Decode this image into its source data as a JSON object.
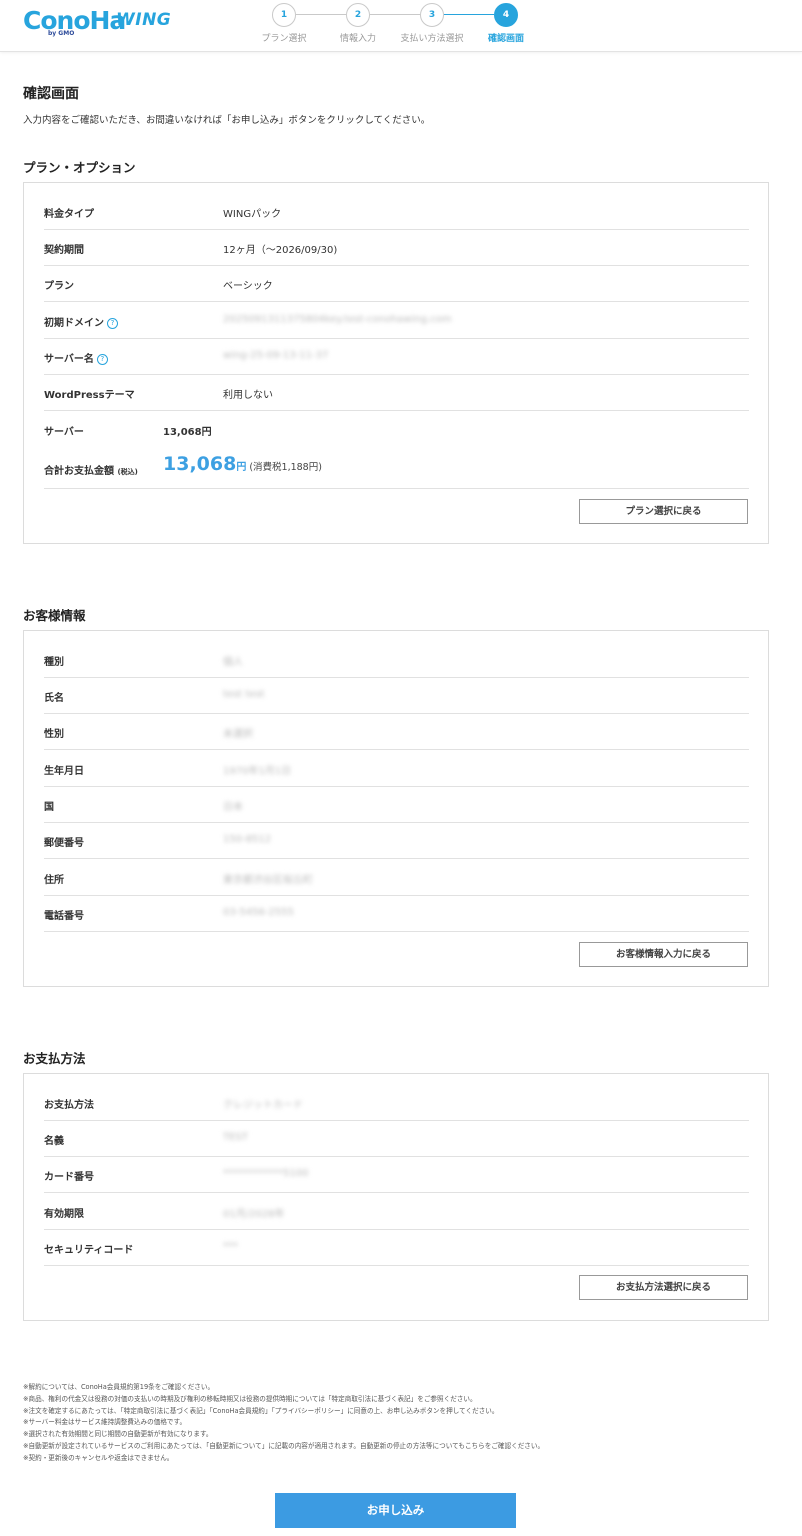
{
  "brand": {
    "logo_main": "ConoHa",
    "logo_sub": "by GMO",
    "logo_wing": "WING"
  },
  "stepper": [
    {
      "num": "1",
      "label": "プラン選択"
    },
    {
      "num": "2",
      "label": "情報入力"
    },
    {
      "num": "3",
      "label": "支払い方法選択"
    },
    {
      "num": "4",
      "label": "確認画面"
    }
  ],
  "page": {
    "title": "確認画面",
    "description": "入力内容をご確認いただき、お間違いなければ「お申し込み」ボタンをクリックしてください。"
  },
  "plan_section": {
    "title": "プラン・オプション",
    "rows": [
      {
        "label": "料金タイプ",
        "value": "WINGパック"
      },
      {
        "label": "契約期間",
        "value": "12ヶ月（〜2026/09/30)"
      },
      {
        "label": "プラン",
        "value": "ベーシック"
      },
      {
        "label": "初期ドメイン",
        "value": "2025091311375804key.test-conohawing.com"
      },
      {
        "label": "サーバー名",
        "value": "wing-25-09-13-11-37"
      },
      {
        "label": "WordPressテーマ",
        "value": "利用しない"
      }
    ],
    "server_label": "サーバー",
    "server_price": "13,068円",
    "total_label": "合計お支払金額",
    "total_tax_note": "(税込)",
    "total_amount": "13,068",
    "total_yen": "円",
    "total_tax": "(消費税1,188円)",
    "back_button": "プラン選択に戻る"
  },
  "customer_section": {
    "title": "お客様情報",
    "rows": [
      {
        "label": "種別",
        "value": "個人"
      },
      {
        "label": "氏名",
        "value": "test test"
      },
      {
        "label": "性別",
        "value": "未選択"
      },
      {
        "label": "生年月日",
        "value": "1970年1月1日"
      },
      {
        "label": "国",
        "value": "日本"
      },
      {
        "label": "郵便番号",
        "value": "150-8512"
      },
      {
        "label": "住所",
        "value": "東京都渋谷区桜丘町"
      },
      {
        "label": "電話番号",
        "value": "03-5456-2555"
      }
    ],
    "back_button": "お客様情報入力に戻る"
  },
  "payment_section": {
    "title": "お支払方法",
    "rows": [
      {
        "label": "お支払方法",
        "value": "クレジットカード"
      },
      {
        "label": "名義",
        "value": "TEST"
      },
      {
        "label": "カード番号",
        "value": "************5100"
      },
      {
        "label": "有効期限",
        "value": "01月/2028年"
      },
      {
        "label": "セキュリティコード",
        "value": "***"
      }
    ],
    "back_button": "お支払方法選択に戻る"
  },
  "notes": [
    "※解約については、ConoHa会員規約第19条をご確認ください。",
    "※商品、権利の代金又は役務の対価の支払いの時期及び権利の移転時期又は役務の提供時期については「特定商取引法に基づく表記」をご参照ください。",
    "※注文を確定するにあたっては、「特定商取引法に基づく表記」「ConoHa会員規約」「プライバシーポリシー」に同意の上、お申し込みボタンを押してください。",
    "※サーバー料金はサービス維持調整費込みの価格です。",
    "※選択された有効期間と同じ期間の自動更新が有効になります。",
    "※自動更新が設定されているサービスのご利用にあたっては、「自動更新について」に記載の内容が適用されます。自動更新の停止の方法等についてもこちらをご確認ください。",
    "※契約・更新後のキャンセルや返金はできません。"
  ],
  "submit_button": "お申し込み",
  "colors": {
    "accent": "#27a4dd",
    "button": "#3c9be2"
  }
}
